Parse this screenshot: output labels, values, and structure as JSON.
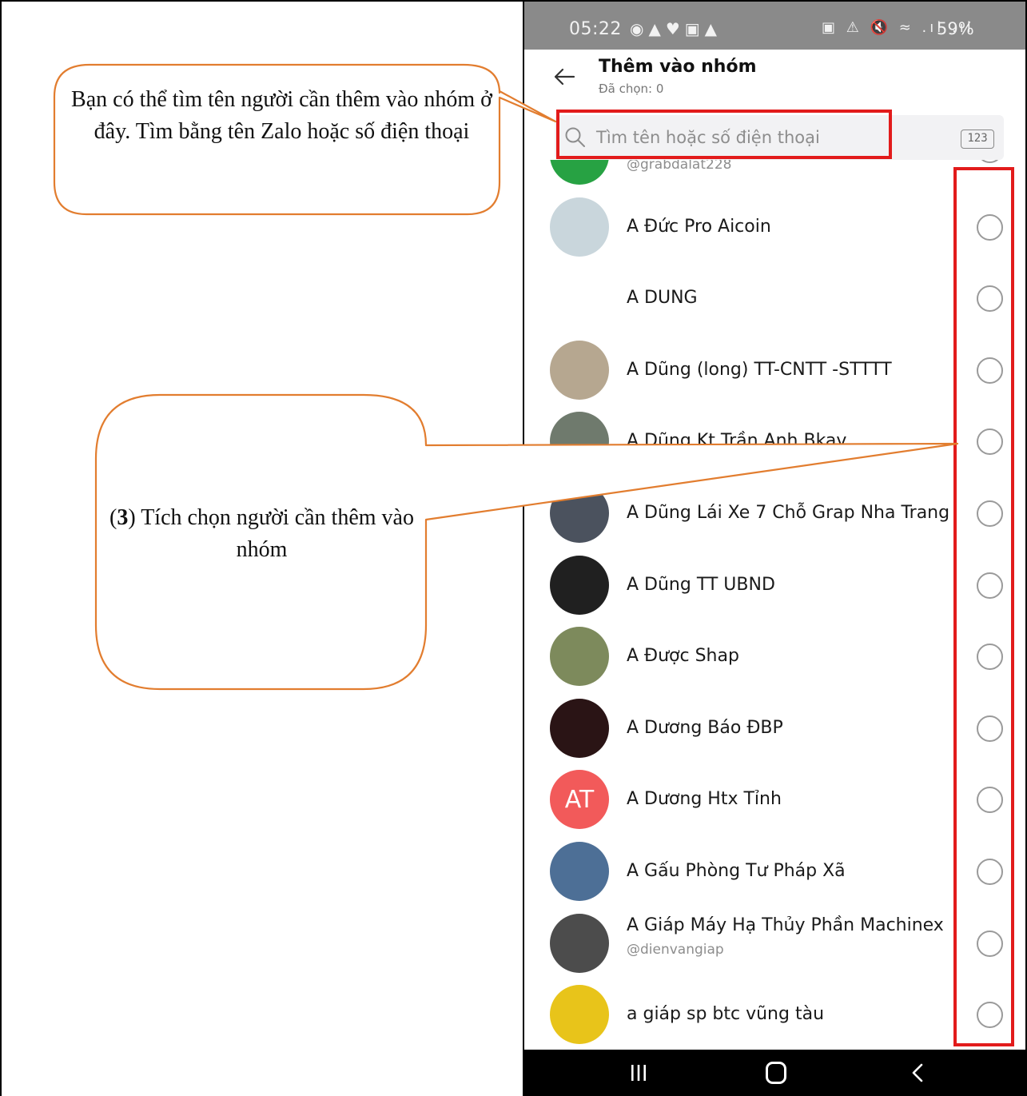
{
  "status_bar": {
    "time": "05:22",
    "left_icons": "◉▲♥▣▲",
    "right_icons": "▣ ⚠ 🔇 ≈ .ıl .ıl",
    "battery": "59%"
  },
  "header": {
    "title": "Thêm vào nhóm",
    "subtitle": "Đã chọn: 0"
  },
  "search": {
    "placeholder": "Tìm tên hoặc số điện thoại",
    "keypad_label": "123"
  },
  "contacts": [
    {
      "name": "",
      "handle": "@grabdalat228",
      "avatar_color": "#27a243",
      "partial": true
    },
    {
      "name": "A Đức Pro Aicoin",
      "avatar_color": "#c9d6dc"
    },
    {
      "name": "A DUNG",
      "avatar_color": "#ffffff"
    },
    {
      "name": "A Dũng (long) TT-CNTT -STTTT",
      "avatar_color": "#b6a790"
    },
    {
      "name": "A Dũng Kt Trần Anh Bkav",
      "avatar_color": "#6f7a6d"
    },
    {
      "name": "A Dũng Lái Xe 7 Chỗ Grap Nha Trang",
      "avatar_color": "#4b525e"
    },
    {
      "name": "A Dũng TT UBND",
      "avatar_color": "#202020"
    },
    {
      "name": "A Được Shap",
      "avatar_color": "#7d8a5c"
    },
    {
      "name": "A Dương Báo ĐBP",
      "avatar_color": "#2a1415"
    },
    {
      "name": "A Dương Htx Tỉnh",
      "avatar_color": "#f25a5a",
      "initials": "AT"
    },
    {
      "name": "A Gấu Phòng Tư Pháp Xã",
      "avatar_color": "#4d6f96"
    },
    {
      "name": "A Giáp Máy Hạ Thủy Phần Machinex",
      "handle": "@dienvangiap",
      "avatar_color": "#4c4c4c"
    },
    {
      "name": "a giáp sp btc vũng tàu",
      "avatar_color": "#e8c41a"
    }
  ],
  "callouts": {
    "search_hint": "Bạn có thể tìm tên người cần thêm vào nhóm ở đây. Tìm bằng tên Zalo hoặc số điện thoại",
    "step_number": "3",
    "step_text": "Tích chọn người cần thêm vào nhóm"
  },
  "colors": {
    "highlight_red": "#e21b1b",
    "callout_orange": "#e27d2f",
    "status_gray": "#8a8a8a"
  }
}
